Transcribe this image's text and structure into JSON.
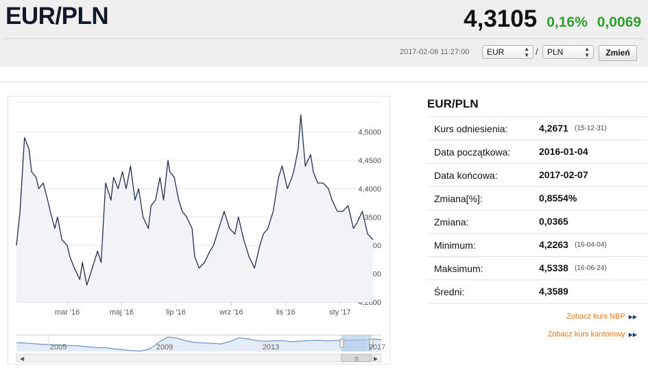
{
  "header": {
    "pair": "EUR/PLN",
    "rate": "4,3105",
    "change_pct": "0,16%",
    "change_abs": "0,0069",
    "timestamp": "2017-02-08 11:27:00",
    "from_currency": "EUR",
    "to_currency": "PLN",
    "separator": "/",
    "submit_label": "Zmień"
  },
  "colors": {
    "positive": "#2fa12f",
    "line": "#1f2d4d",
    "link": "#e8751a",
    "navigator_fill": "#a9c6e8"
  },
  "chart_data": {
    "type": "line",
    "title": "",
    "xlabel": "",
    "ylabel": "",
    "ylim": [
      4.2,
      4.5
    ],
    "y_ticks": [
      "4,2000",
      "4,2500",
      "4,3000",
      "4,3500",
      "4,4000",
      "4,4500",
      "4,5000"
    ],
    "x_ticks": [
      "mar '16",
      "maj '16",
      "lip '16",
      "wrz '16",
      "lis '16",
      "sty '17"
    ],
    "grid": true,
    "series": [
      {
        "x": [
          "2016-01-04",
          "2016-01-08",
          "2016-01-13",
          "2016-01-18",
          "2016-01-21",
          "2016-01-26",
          "2016-01-29",
          "2016-02-03",
          "2016-02-08",
          "2016-02-11",
          "2016-02-16",
          "2016-02-19",
          "2016-02-24",
          "2016-03-01",
          "2016-03-04",
          "2016-03-09",
          "2016-03-15",
          "2016-03-18",
          "2016-03-23",
          "2016-03-29",
          "2016-04-04",
          "2016-04-08",
          "2016-04-13",
          "2016-04-19",
          "2016-04-22",
          "2016-04-27",
          "2016-05-02",
          "2016-05-06",
          "2016-05-11",
          "2016-05-16",
          "2016-05-20",
          "2016-05-25",
          "2016-05-31",
          "2016-06-03",
          "2016-06-08",
          "2016-06-13",
          "2016-06-17",
          "2016-06-22",
          "2016-06-24",
          "2016-06-29",
          "2016-07-04",
          "2016-07-08",
          "2016-07-13",
          "2016-07-19",
          "2016-07-22",
          "2016-07-27",
          "2016-08-02",
          "2016-08-08",
          "2016-08-12",
          "2016-08-18",
          "2016-08-24",
          "2016-08-30",
          "2016-09-05",
          "2016-09-09",
          "2016-09-15",
          "2016-09-21",
          "2016-09-27",
          "2016-10-03",
          "2016-10-07",
          "2016-10-12",
          "2016-10-18",
          "2016-10-24",
          "2016-10-28",
          "2016-11-03",
          "2016-11-08",
          "2016-11-10",
          "2016-11-15",
          "2016-11-18",
          "2016-11-23",
          "2016-11-29",
          "2016-12-02",
          "2016-12-07",
          "2016-12-13",
          "2016-12-19",
          "2016-12-23",
          "2016-12-29",
          "2017-01-04",
          "2017-01-10",
          "2017-01-16",
          "2017-01-20",
          "2017-01-26",
          "2017-02-01",
          "2017-02-07"
        ],
        "values": [
          4.3,
          4.36,
          4.49,
          4.47,
          4.43,
          4.42,
          4.4,
          4.41,
          4.38,
          4.36,
          4.33,
          4.35,
          4.31,
          4.3,
          4.28,
          4.26,
          4.24,
          4.27,
          4.23,
          4.26,
          4.29,
          4.27,
          4.41,
          4.38,
          4.42,
          4.4,
          4.43,
          4.4,
          4.44,
          4.38,
          4.4,
          4.35,
          4.33,
          4.37,
          4.38,
          4.42,
          4.38,
          4.45,
          4.43,
          4.42,
          4.38,
          4.36,
          4.35,
          4.33,
          4.28,
          4.26,
          4.27,
          4.29,
          4.3,
          4.33,
          4.36,
          4.33,
          4.32,
          4.35,
          4.31,
          4.28,
          4.26,
          4.3,
          4.32,
          4.33,
          4.36,
          4.42,
          4.44,
          4.4,
          4.42,
          4.43,
          4.47,
          4.53,
          4.44,
          4.46,
          4.43,
          4.41,
          4.41,
          4.4,
          4.38,
          4.36,
          4.36,
          4.37,
          4.33,
          4.34,
          4.36,
          4.32,
          4.31
        ]
      }
    ],
    "navigator": {
      "x_ticks": [
        "2005",
        "2009",
        "2013",
        "2017"
      ],
      "values": [
        4.02,
        3.98,
        3.92,
        3.87,
        3.82,
        3.79,
        3.76,
        3.72,
        3.64,
        3.57,
        3.55,
        3.45,
        3.36,
        3.28,
        3.25,
        3.45,
        4.05,
        4.55,
        4.45,
        4.2,
        4.05,
        4.0,
        3.95,
        3.9,
        4.12,
        4.48,
        4.38,
        4.22,
        4.15,
        4.2,
        4.2,
        4.1,
        4.18,
        4.22,
        4.25,
        4.18,
        4.23,
        4.24,
        4.26,
        4.28,
        4.35,
        4.31
      ]
    }
  },
  "stats": {
    "title": "EUR/PLN",
    "rows": [
      {
        "label": "Kurs odniesienia:",
        "value": "4,2671",
        "note": "(15-12-31)"
      },
      {
        "label": "Data początkowa:",
        "value": "2016-01-04",
        "note": ""
      },
      {
        "label": "Data końcowa:",
        "value": "2017-02-07",
        "note": ""
      },
      {
        "label": "Zmiana[%]:",
        "value": "0,8554%",
        "note": ""
      },
      {
        "label": "Zmiana:",
        "value": "0,0365",
        "note": ""
      },
      {
        "label": "Minimum:",
        "value": "4,2263",
        "note": "(16-04-04)"
      },
      {
        "label": "Maksimum:",
        "value": "4,5338",
        "note": "(16-06-24)"
      },
      {
        "label": "Średni:",
        "value": "4,3589",
        "note": ""
      }
    ]
  },
  "links": {
    "nbp": "Zobacz kurs NBP",
    "kantor": "Zobacz kurs kantorowy"
  }
}
